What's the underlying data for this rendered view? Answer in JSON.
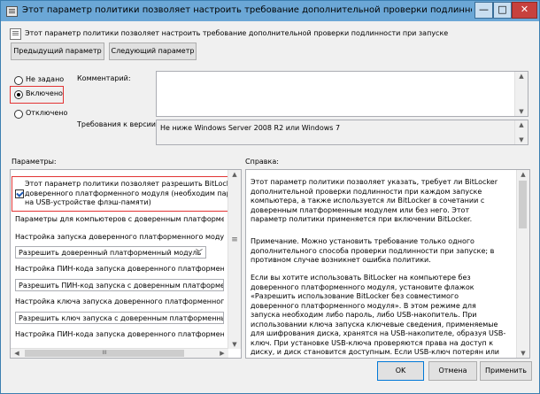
{
  "window": {
    "title": "Этот параметр политики позволяет настроить требование дополнительной проверки подлинности при ...",
    "min_label": "—",
    "max_label": "□",
    "close_label": "✕"
  },
  "header": {
    "text": "Этот параметр политики позволяет настроить требование дополнительной проверки подлинности при запуске",
    "prev_button": "Предыдущий параметр",
    "next_button": "Следующий параметр"
  },
  "state": {
    "options": [
      "Не задано",
      "Включено",
      "Отключено"
    ],
    "selected_index": 1
  },
  "comment": {
    "label": "Комментарий:",
    "value": ""
  },
  "requirements": {
    "label": "Требования к версии:",
    "value": "Не ниже Windows Server 2008 R2 или Windows 7"
  },
  "params": {
    "label": "Параметры:",
    "checkbox_line1": "Этот параметр политики позволяет разрешить BitLocker без с",
    "checkbox_line2": "доверенного платформенного модуля (необходим пароль или",
    "checkbox_line3": "на USB-устройстве флэш-памяти)",
    "text1": "Параметры для компьютеров с доверенным платформенным м",
    "text2": "Настройка запуска доверенного платформенного модуля.",
    "dropdown1": "Разрешить доверенный платформенный модуль",
    "text3": "Настройка ПИН-кода запуска доверенного платформенного мо",
    "dropdown2": "Разрешить ПИН-код запуска с доверенным платформенным м",
    "text4": "Настройка ключа запуска доверенного платформенного моду",
    "dropdown3": "Разрешить ключ запуска с доверенным платформенным моду",
    "text5": "Настройка ПИН-кода запуска доверенного платформенного мо",
    "scroll_grip": "III"
  },
  "help": {
    "label": "Справка:",
    "p1": "Этот параметр политики позволяет указать, требует ли BitLocker дополнительной проверки подлинности при каждом запуске компьютера, а также используется ли BitLocker в сочетании с доверенным платформенным модулем или без него. Этот параметр политики применяется при включении BitLocker.",
    "p2": "Примечание. Можно установить требование только одного дополнительного способа проверки подлинности при запуске; в противном случае возникнет ошибка политики.",
    "p3": "Если вы хотите использовать BitLocker на компьютере без доверенного платформенного модуля, установите флажок «Разрешить использование BitLocker без совместимого доверенного платформенного модуля». В этом режиме для запуска необходим либо пароль, либо USB-накопитель. При использовании ключа запуска ключевые сведения, применяемые для шифрования диска, хранятся на USB-накопителе, образуя USB-ключ. При установке USB-ключа проверяются права на доступ к диску, и диск становится доступным. Если USB-ключ потерян или недоступен или вы забыли пароль, вам придется воспользоваться одним из параметров восстановления BitLocker,"
  },
  "footer": {
    "ok": "OK",
    "cancel": "Отмена",
    "apply": "Применить"
  }
}
